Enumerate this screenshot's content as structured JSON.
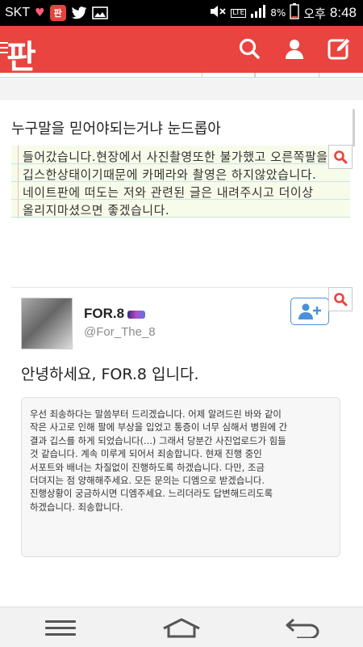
{
  "status_bar": {
    "carrier": "SKT",
    "battery_percent": "8%",
    "ampm": "오후",
    "time": "8:48",
    "network": "LTE",
    "app_badge": "판"
  },
  "app_header": {
    "logo": "판",
    "accent_color": "#e9443f",
    "icons": [
      "search-icon",
      "user-icon",
      "write-icon"
    ]
  },
  "post": {
    "title": "누구말을 믿어야되는거냐 눈드롭아",
    "image1_lines": [
      "들어갔습니다.현장에서 사진촬영또한 불가했고 오른쪽팔을",
      "깁스한상태이기때문에 카메라와 촬영은 하지않았습니다.",
      "네이트판에 떠도는 저와 관련된 글은 내려주시고 더이상",
      "올리지마셨으면 좋겠습니다."
    ],
    "tweet": {
      "name": "FOR.8",
      "handle": "@For_The_8",
      "greeting": "안녕하세요, FOR.8 입니다.",
      "quote_lines": [
        "우선 죄송하다는 말씀부터 드리겠습니다. 어제 알려드린 바와 같이",
        "작은 사고로 인해 팔에 부상을 입었고 통증이 너무 심해서 병원에 간",
        "결과 깁스를 하게 되었습니다(...) 그래서 당분간 사진업로드가 힘들",
        "것 같습니다. 계속 미루게 되어서 죄송합니다. 현재 진행 중인",
        "서포트와 배너는 차질없이 진행하도록 하겠습니다. 다만, 조금",
        "더뎌지는 점 양해해주세요. 모든 문의는 디엠으로 받겠습니다.",
        "진행상황이 궁금하시면 디엠주세요. 느리더라도 답변해드리도록",
        "하겠습니다. 죄송합니다."
      ]
    }
  },
  "nav_bar": {
    "buttons": [
      "menu-icon",
      "home-icon",
      "back-icon"
    ]
  }
}
